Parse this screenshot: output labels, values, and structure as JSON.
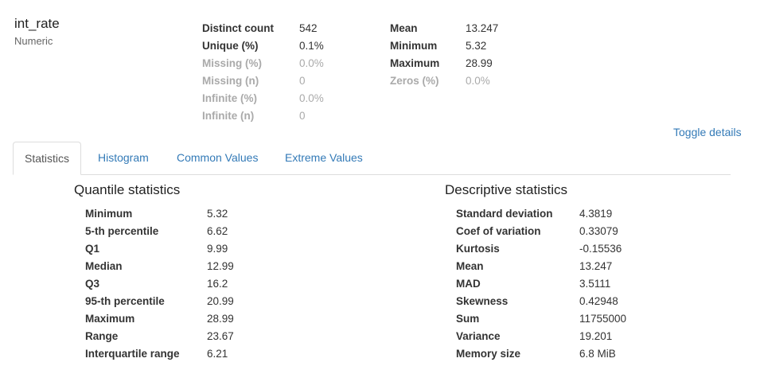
{
  "variable": {
    "name": "int_rate",
    "type": "Numeric"
  },
  "overview_left": [
    {
      "label": "Distinct count",
      "value": "542",
      "muted": false
    },
    {
      "label": "Unique (%)",
      "value": "0.1%",
      "muted": false
    },
    {
      "label": "Missing (%)",
      "value": "0.0%",
      "muted": true
    },
    {
      "label": "Missing (n)",
      "value": "0",
      "muted": true
    },
    {
      "label": "Infinite (%)",
      "value": "0.0%",
      "muted": true
    },
    {
      "label": "Infinite (n)",
      "value": "0",
      "muted": true
    }
  ],
  "overview_right": [
    {
      "label": "Mean",
      "value": "13.247",
      "muted": false
    },
    {
      "label": "Minimum",
      "value": "5.32",
      "muted": false
    },
    {
      "label": "Maximum",
      "value": "28.99",
      "muted": false
    },
    {
      "label": "Zeros (%)",
      "value": "0.0%",
      "muted": true
    }
  ],
  "toggle_label": "Toggle details",
  "tabs": {
    "statistics": "Statistics",
    "histogram": "Histogram",
    "common_values": "Common Values",
    "extreme_values": "Extreme Values"
  },
  "quantile": {
    "title": "Quantile statistics",
    "rows": [
      {
        "label": "Minimum",
        "value": "5.32"
      },
      {
        "label": "5-th percentile",
        "value": "6.62"
      },
      {
        "label": "Q1",
        "value": "9.99"
      },
      {
        "label": "Median",
        "value": "12.99"
      },
      {
        "label": "Q3",
        "value": "16.2"
      },
      {
        "label": "95-th percentile",
        "value": "20.99"
      },
      {
        "label": "Maximum",
        "value": "28.99"
      },
      {
        "label": "Range",
        "value": "23.67"
      },
      {
        "label": "Interquartile range",
        "value": "6.21"
      }
    ]
  },
  "descriptive": {
    "title": "Descriptive statistics",
    "rows": [
      {
        "label": "Standard deviation",
        "value": "4.3819"
      },
      {
        "label": "Coef of variation",
        "value": "0.33079"
      },
      {
        "label": "Kurtosis",
        "value": "-0.15536"
      },
      {
        "label": "Mean",
        "value": "13.247"
      },
      {
        "label": "MAD",
        "value": "3.5111"
      },
      {
        "label": "Skewness",
        "value": "0.42948"
      },
      {
        "label": "Sum",
        "value": "11755000"
      },
      {
        "label": "Variance",
        "value": "19.201"
      },
      {
        "label": "Memory size",
        "value": "6.8 MiB"
      }
    ]
  }
}
